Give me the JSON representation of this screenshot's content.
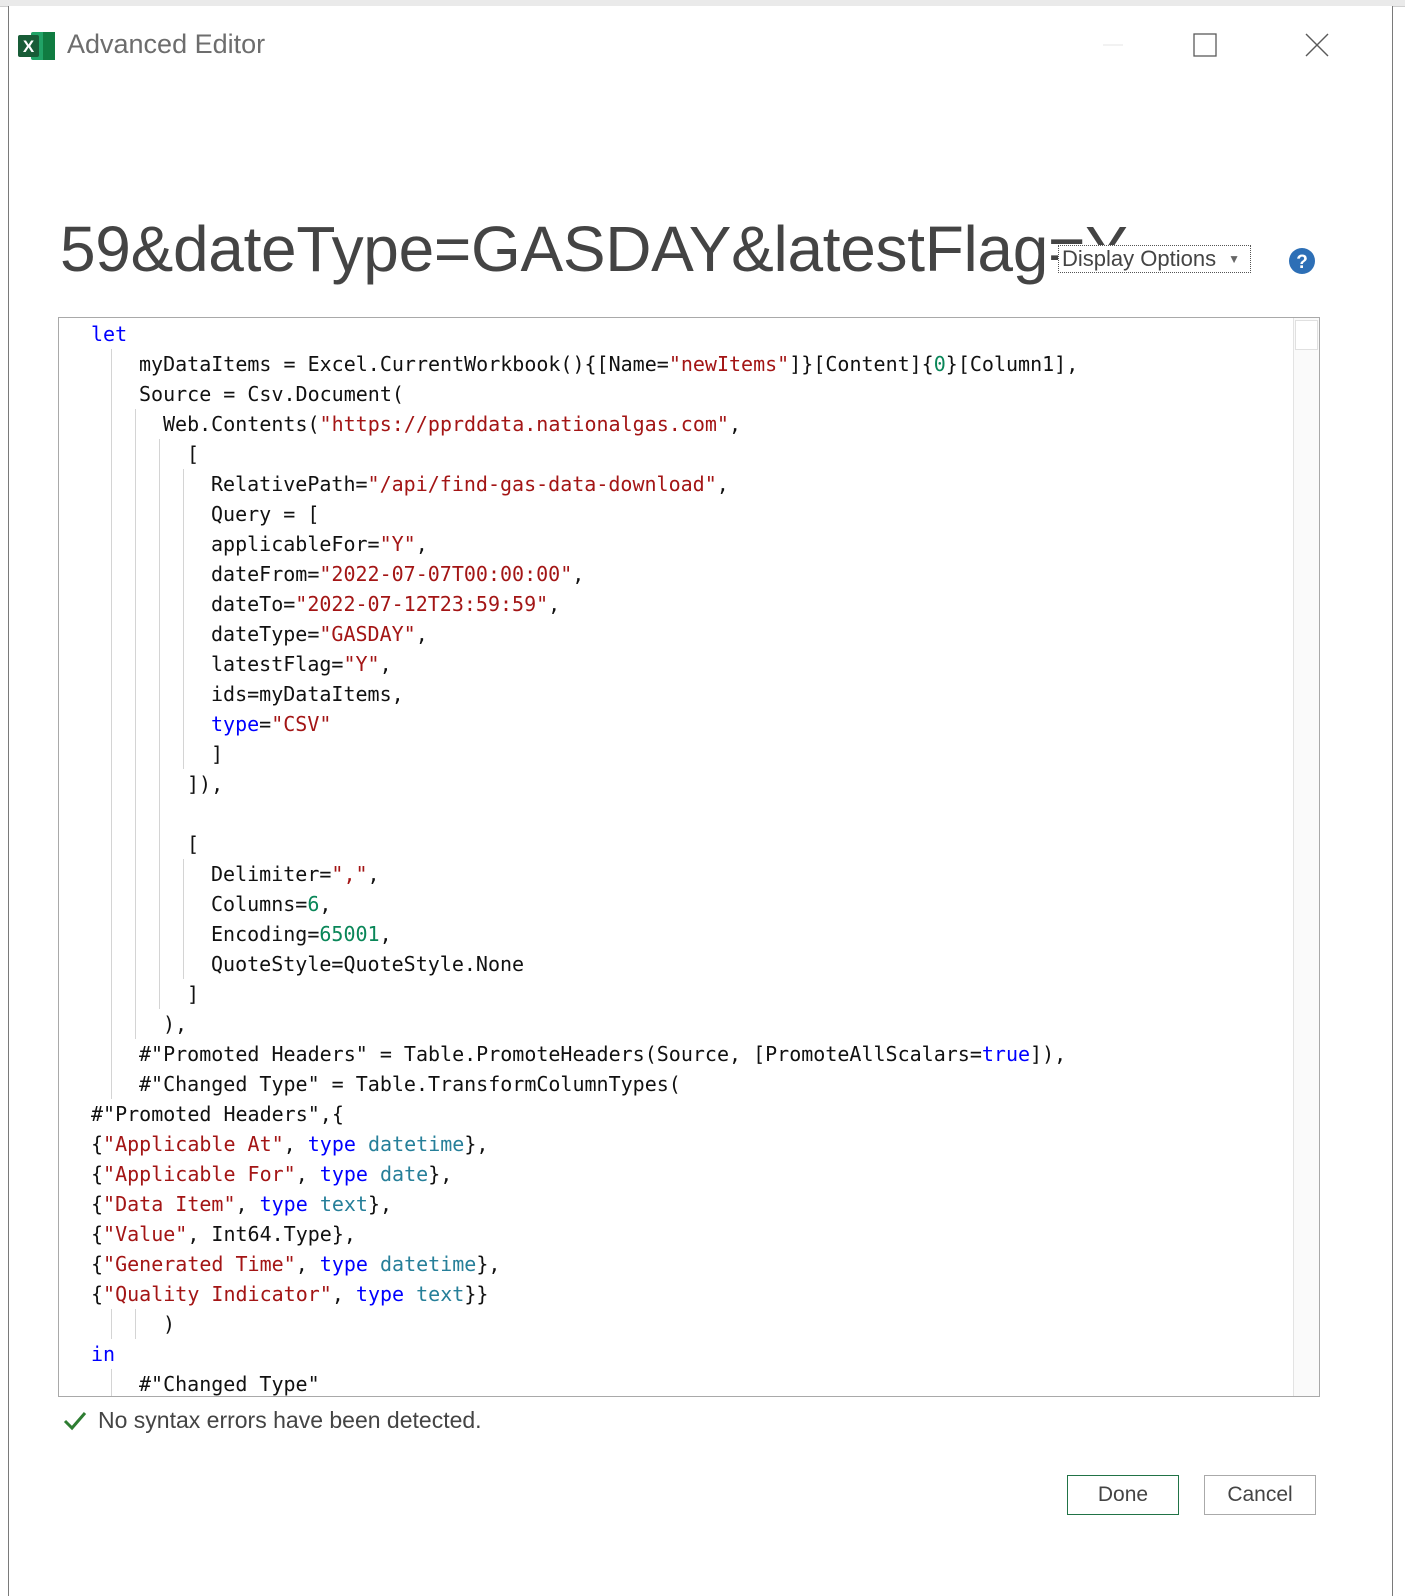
{
  "window": {
    "title": "Advanced Editor",
    "app_icon": "excel-icon"
  },
  "query_title": "59&dateType=GASDAY&latestFlag=Y...",
  "display_options": {
    "label": "Display Options"
  },
  "help": {
    "icon": "help-icon"
  },
  "colors": {
    "keyword": "#0000ff",
    "string": "#a31515",
    "number": "#098658",
    "type": "#267f99",
    "success": "#2e7d32",
    "excel_green": "#217346"
  },
  "editor": {
    "lines": [
      {
        "indent": 0,
        "tokens": [
          [
            "kw",
            "let"
          ]
        ]
      },
      {
        "indent": 2,
        "tokens": [
          [
            "t",
            "myDataItems = Excel.CurrentWorkbook(){[Name="
          ],
          [
            "str",
            "\"newItems\""
          ],
          [
            "t",
            "]}[Content]{"
          ],
          [
            "num",
            "0"
          ],
          [
            "t",
            "}[Column1],"
          ]
        ]
      },
      {
        "indent": 2,
        "tokens": [
          [
            "t",
            "Source = Csv.Document("
          ]
        ]
      },
      {
        "indent": 3,
        "tokens": [
          [
            "t",
            "Web.Contents("
          ],
          [
            "str",
            "\"https://pprddata.nationalgas.com\""
          ],
          [
            "t",
            ","
          ]
        ]
      },
      {
        "indent": 4,
        "tokens": [
          [
            "t",
            "["
          ]
        ]
      },
      {
        "indent": 5,
        "tokens": [
          [
            "t",
            "RelativePath="
          ],
          [
            "str",
            "\"/api/find-gas-data-download\""
          ],
          [
            "t",
            ","
          ]
        ]
      },
      {
        "indent": 5,
        "tokens": [
          [
            "t",
            "Query = ["
          ]
        ]
      },
      {
        "indent": 5,
        "tokens": [
          [
            "t",
            "applicableFor="
          ],
          [
            "str",
            "\"Y\""
          ],
          [
            "t",
            ","
          ]
        ]
      },
      {
        "indent": 5,
        "tokens": [
          [
            "t",
            "dateFrom="
          ],
          [
            "str",
            "\"2022-07-07T00:00:00\""
          ],
          [
            "t",
            ","
          ]
        ]
      },
      {
        "indent": 5,
        "tokens": [
          [
            "t",
            "dateTo="
          ],
          [
            "str",
            "\"2022-07-12T23:59:59\""
          ],
          [
            "t",
            ","
          ]
        ]
      },
      {
        "indent": 5,
        "tokens": [
          [
            "t",
            "dateType="
          ],
          [
            "str",
            "\"GASDAY\""
          ],
          [
            "t",
            ","
          ]
        ]
      },
      {
        "indent": 5,
        "tokens": [
          [
            "t",
            "latestFlag="
          ],
          [
            "str",
            "\"Y\""
          ],
          [
            "t",
            ","
          ]
        ]
      },
      {
        "indent": 5,
        "tokens": [
          [
            "t",
            "ids=myDataItems,"
          ]
        ]
      },
      {
        "indent": 5,
        "tokens": [
          [
            "kw",
            "type"
          ],
          [
            "t",
            "="
          ],
          [
            "str",
            "\"CSV\""
          ]
        ]
      },
      {
        "indent": 5,
        "tokens": [
          [
            "t",
            "]"
          ]
        ]
      },
      {
        "indent": 4,
        "tokens": [
          [
            "t",
            "]),"
          ]
        ]
      },
      {
        "indent": 4,
        "tokens": []
      },
      {
        "indent": 4,
        "tokens": [
          [
            "t",
            "["
          ]
        ]
      },
      {
        "indent": 5,
        "tokens": [
          [
            "t",
            "Delimiter="
          ],
          [
            "str",
            "\",\""
          ],
          [
            "t",
            ","
          ]
        ]
      },
      {
        "indent": 5,
        "tokens": [
          [
            "t",
            "Columns="
          ],
          [
            "num",
            "6"
          ],
          [
            "t",
            ","
          ]
        ]
      },
      {
        "indent": 5,
        "tokens": [
          [
            "t",
            "Encoding="
          ],
          [
            "num",
            "65001"
          ],
          [
            "t",
            ","
          ]
        ]
      },
      {
        "indent": 5,
        "tokens": [
          [
            "t",
            "QuoteStyle=QuoteStyle.None"
          ]
        ]
      },
      {
        "indent": 4,
        "tokens": [
          [
            "t",
            "]"
          ]
        ]
      },
      {
        "indent": 3,
        "tokens": [
          [
            "t",
            "),"
          ]
        ]
      },
      {
        "indent": 2,
        "tokens": [
          [
            "t",
            "#\"Promoted Headers\" = Table.PromoteHeaders(Source, [PromoteAllScalars="
          ],
          [
            "kw",
            "true"
          ],
          [
            "t",
            "]),"
          ]
        ]
      },
      {
        "indent": 2,
        "tokens": [
          [
            "t",
            "#\"Changed Type\" = Table.TransformColumnTypes("
          ]
        ]
      },
      {
        "indent": 0,
        "tokens": [
          [
            "t",
            "#\"Promoted Headers\",{"
          ]
        ]
      },
      {
        "indent": 0,
        "tokens": [
          [
            "t",
            "{"
          ],
          [
            "str",
            "\"Applicable At\""
          ],
          [
            "t",
            ", "
          ],
          [
            "kw",
            "type"
          ],
          [
            "t",
            " "
          ],
          [
            "typ",
            "datetime"
          ],
          [
            "t",
            "},"
          ]
        ]
      },
      {
        "indent": 0,
        "tokens": [
          [
            "t",
            "{"
          ],
          [
            "str",
            "\"Applicable For\""
          ],
          [
            "t",
            ", "
          ],
          [
            "kw",
            "type"
          ],
          [
            "t",
            " "
          ],
          [
            "typ",
            "date"
          ],
          [
            "t",
            "},"
          ]
        ]
      },
      {
        "indent": 0,
        "tokens": [
          [
            "t",
            "{"
          ],
          [
            "str",
            "\"Data Item\""
          ],
          [
            "t",
            ", "
          ],
          [
            "kw",
            "type"
          ],
          [
            "t",
            " "
          ],
          [
            "typ",
            "text"
          ],
          [
            "t",
            "},"
          ]
        ]
      },
      {
        "indent": 0,
        "tokens": [
          [
            "t",
            "{"
          ],
          [
            "str",
            "\"Value\""
          ],
          [
            "t",
            ", Int64.Type},"
          ]
        ]
      },
      {
        "indent": 0,
        "tokens": [
          [
            "t",
            "{"
          ],
          [
            "str",
            "\"Generated Time\""
          ],
          [
            "t",
            ", "
          ],
          [
            "kw",
            "type"
          ],
          [
            "t",
            " "
          ],
          [
            "typ",
            "datetime"
          ],
          [
            "t",
            "},"
          ]
        ]
      },
      {
        "indent": 0,
        "tokens": [
          [
            "t",
            "{"
          ],
          [
            "str",
            "\"Quality Indicator\""
          ],
          [
            "t",
            ", "
          ],
          [
            "kw",
            "type"
          ],
          [
            "t",
            " "
          ],
          [
            "typ",
            "text"
          ],
          [
            "t",
            "}}"
          ]
        ]
      },
      {
        "indent": 3,
        "tokens": [
          [
            "t",
            ")"
          ]
        ]
      },
      {
        "indent": 0,
        "tokens": [
          [
            "kw",
            "in"
          ]
        ]
      },
      {
        "indent": 2,
        "tokens": [
          [
            "t",
            "#\"Changed Type\""
          ]
        ]
      }
    ]
  },
  "status": {
    "icon": "checkmark-icon",
    "text": "No syntax errors have been detected."
  },
  "buttons": {
    "done": "Done",
    "cancel": "Cancel"
  }
}
